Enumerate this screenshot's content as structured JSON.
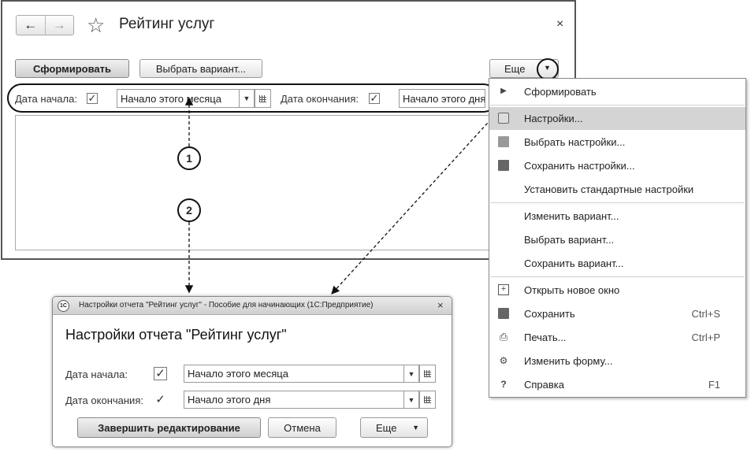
{
  "main_window": {
    "title": "Рейтинг услуг",
    "close": "×",
    "nav": {
      "back": "←",
      "forward": "→"
    },
    "star": "☆",
    "toolbar": {
      "generate": "Сформировать",
      "choose_variant": "Выбрать вариант...",
      "more": "Еще"
    },
    "params": {
      "start_label": "Дата начала:",
      "start_value": "Начало этого месяца",
      "end_label": "Дата окончания:",
      "end_value": "Начало этого дня"
    }
  },
  "markers": {
    "one": "1",
    "two": "2"
  },
  "menu": {
    "items": [
      {
        "label": "Сформировать",
        "icon": "play-icon",
        "glyph": "▶",
        "shortcut": ""
      },
      {
        "label": "Настройки...",
        "icon": "settings-table-gear-icon",
        "glyph": "",
        "shortcut": ""
      },
      {
        "label": "Выбрать настройки...",
        "icon": "folder-gear-icon",
        "glyph": "",
        "shortcut": ""
      },
      {
        "label": "Сохранить настройки...",
        "icon": "disk-gear-icon",
        "glyph": "",
        "shortcut": ""
      },
      {
        "label": "Установить стандартные настройки",
        "icon": "",
        "glyph": "",
        "shortcut": ""
      },
      {
        "label": "Изменить вариант...",
        "icon": "",
        "glyph": "",
        "shortcut": ""
      },
      {
        "label": "Выбрать вариант...",
        "icon": "",
        "glyph": "",
        "shortcut": ""
      },
      {
        "label": "Сохранить вариант...",
        "icon": "",
        "glyph": "",
        "shortcut": ""
      },
      {
        "label": "Открыть новое окно",
        "icon": "new-window-icon",
        "glyph": "+",
        "shortcut": ""
      },
      {
        "label": "Сохранить",
        "icon": "save-disk-icon",
        "glyph": "",
        "shortcut": "Ctrl+S"
      },
      {
        "label": "Печать...",
        "icon": "printer-icon",
        "glyph": "⎙",
        "shortcut": "Ctrl+P"
      },
      {
        "label": "Изменить форму...",
        "icon": "form-gear-icon",
        "glyph": "⚙",
        "shortcut": ""
      },
      {
        "label": "Справка",
        "icon": "help-icon",
        "glyph": "?",
        "shortcut": "F1"
      }
    ]
  },
  "dialog": {
    "logo": "1С",
    "caption": "Настройки отчета \"Рейтинг услуг\" - Пособие для начинающих  (1С:Предприятие)",
    "close": "×",
    "title": "Настройки отчета \"Рейтинг услуг\"",
    "start_label": "Дата начала:",
    "start_value": "Начало этого месяца",
    "end_label": "Дата окончания:",
    "end_value": "Начало этого дня",
    "finish": "Завершить редактирование",
    "cancel": "Отмена",
    "more": "Еще"
  }
}
